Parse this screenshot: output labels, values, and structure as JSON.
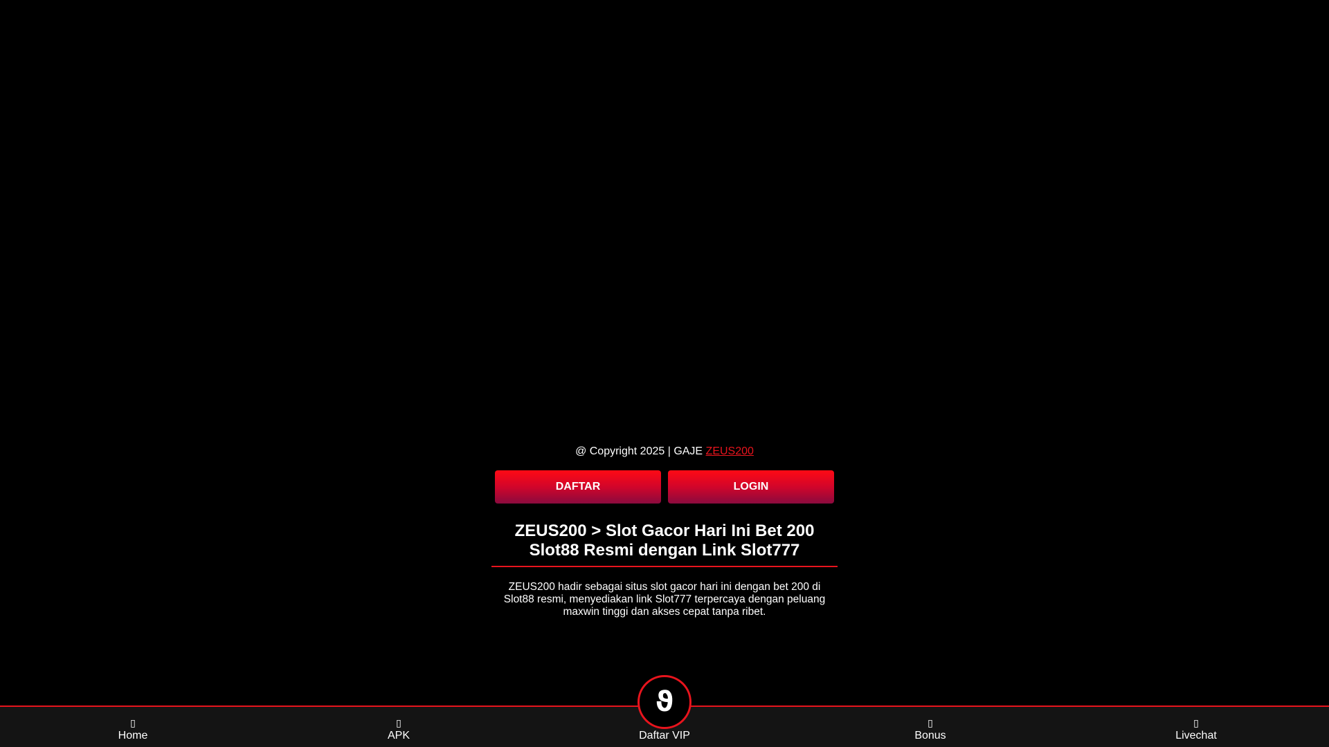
{
  "footer": {
    "copyright_prefix": "@ Copyright 2025 | GAJE ",
    "brand_link": "ZEUS200"
  },
  "auth": {
    "daftar_label": "DAFTAR",
    "login_label": "LOGIN"
  },
  "article": {
    "title": "ZEUS200 > Slot Gacor Hari Ini Bet 200 Slot88 Resmi dengan Link Slot777",
    "description": "ZEUS200 hadir sebagai situs slot gacor hari ini dengan bet 200 di Slot88 resmi, menyediakan link Slot777 terpercaya dengan peluang maxwin tinggi dan akses cepat tanpa ribet."
  },
  "bottom_nav": {
    "items": [
      {
        "label": "Home",
        "icon": "home-icon",
        "glyph": "▯"
      },
      {
        "label": "APK",
        "icon": "download-icon",
        "glyph": "▯"
      },
      {
        "label": "Daftar VIP",
        "icon": "vip-icon",
        "glyph": "ϑ"
      },
      {
        "label": "Bonus",
        "icon": "gift-icon",
        "glyph": "▯"
      },
      {
        "label": "Livechat",
        "icon": "chat-icon",
        "glyph": "▯"
      }
    ]
  },
  "colors": {
    "background": "#000000",
    "accent": "#e8141d",
    "nav_background": "#141414"
  }
}
